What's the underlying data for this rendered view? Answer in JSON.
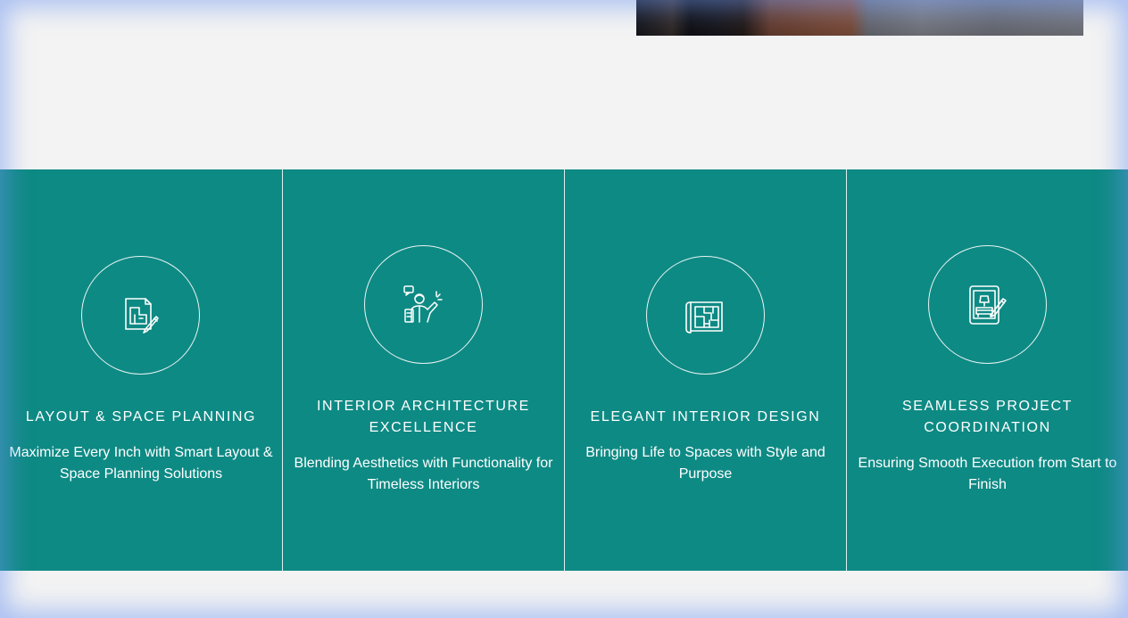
{
  "hero": {
    "image_alt": "interior photo"
  },
  "services": [
    {
      "icon": "floor-plan-pencil-icon",
      "title": "LAYOUT & SPACE PLANNING",
      "description": "Maximize Every Inch with Smart Layout & Space Planning Solutions"
    },
    {
      "icon": "architect-person-icon",
      "title": "INTERIOR ARCHITECTURE EXCELLENCE",
      "description": "Blending Aesthetics with Functionality for Timeless Interiors"
    },
    {
      "icon": "blueprint-icon",
      "title": "ELEGANT INTERIOR DESIGN",
      "description": "Bringing Life to Spaces with Style and Purpose"
    },
    {
      "icon": "tablet-design-icon",
      "title": "SEAMLESS PROJECT COORDINATION",
      "description": "Ensuring Smooth Execution from Start to Finish"
    }
  ],
  "colors": {
    "background": "#f3f3f3",
    "teal": "#0e8a84",
    "text": "#ffffff",
    "frame_glow": "#6e96f0"
  }
}
